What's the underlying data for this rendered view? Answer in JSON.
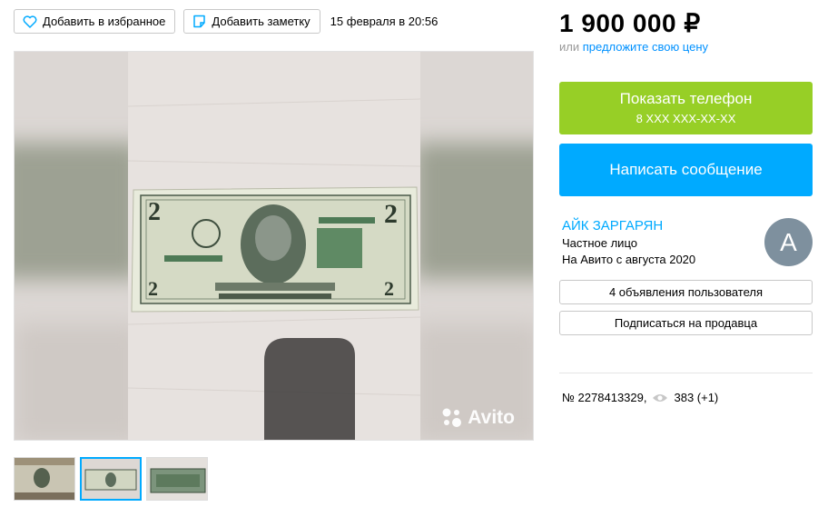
{
  "toolbar": {
    "favorite_label": "Добавить в избранное",
    "note_label": "Добавить заметку",
    "date": "15 февраля в 20:56"
  },
  "gallery": {
    "watermark": "Avito",
    "thumb_count": 3,
    "active_thumb": 2
  },
  "price": {
    "value": "1 900 000 ₽",
    "prefix": "или",
    "offer_link": "предложите свою цену"
  },
  "contact": {
    "show_phone_label": "Показать телефон",
    "phone_mask": "8 XXX XXX-XX-XX",
    "message_label": "Написать сообщение"
  },
  "seller": {
    "name": "АЙК ЗАРГАРЯН",
    "type": "Частное лицо",
    "since": "На Авито с августа 2020",
    "avatar_letter": "А",
    "ads_button": "4 объявления пользователя",
    "subscribe_button": "Подписаться на продавца"
  },
  "listing": {
    "number": "№ 2278413329,",
    "views": "383 (+1)"
  },
  "colors": {
    "green": "#97cf26",
    "blue": "#00aaff",
    "link": "#0091ff",
    "avatar": "#7e909e"
  }
}
